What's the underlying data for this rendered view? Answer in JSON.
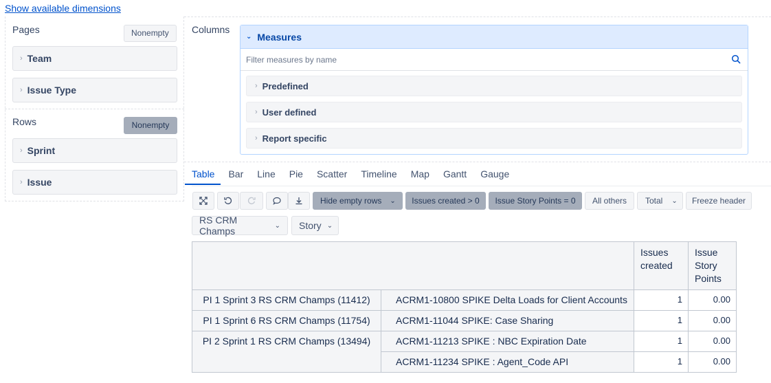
{
  "show_dimensions_link": "Show available dimensions",
  "pages": {
    "label": "Pages",
    "nonempty_label": "Nonempty",
    "items": [
      "Team",
      "Issue Type"
    ]
  },
  "rows": {
    "label": "Rows",
    "nonempty_label": "Nonempty",
    "items": [
      "Sprint",
      "Issue"
    ]
  },
  "columns": {
    "label": "Columns",
    "measures_title": "Measures",
    "filter_placeholder": "Filter measures by name",
    "groups": [
      "Predefined",
      "User defined",
      "Report specific"
    ]
  },
  "tabs": [
    "Table",
    "Bar",
    "Line",
    "Pie",
    "Scatter",
    "Timeline",
    "Map",
    "Gantt",
    "Gauge"
  ],
  "active_tab": "Table",
  "toolbar": {
    "hide_empty_rows": "Hide empty rows",
    "issues_created_filter": "Issues created > 0",
    "story_points_filter": "Issue Story Points = 0",
    "all_others": "All others",
    "total": "Total",
    "freeze_header": "Freeze header",
    "icons": [
      "expand-icon",
      "undo-icon",
      "redo-icon",
      "comment-icon",
      "download-icon"
    ]
  },
  "page_filters": {
    "team": "RS CRM Champs",
    "issue_type": "Story"
  },
  "table": {
    "headers": [
      "Issues created",
      "Issue Story Points"
    ],
    "header_lines": [
      [
        "Issues",
        "created"
      ],
      [
        "Issue",
        "Story",
        "Points"
      ]
    ],
    "rows": [
      {
        "sprint": "PI 1 Sprint 3 RS CRM Champs (11412)",
        "issue": "ACRM1-10800 SPIKE Delta Loads for Client Accounts",
        "issues_created": "1",
        "story_points": "0.00"
      },
      {
        "sprint": "PI 1 Sprint 6 RS CRM Champs (11754)",
        "issue": "ACRM1-11044 SPIKE: Case Sharing",
        "issues_created": "1",
        "story_points": "0.00"
      },
      {
        "sprint": "PI 2 Sprint 1 RS CRM Champs (13494)",
        "issue": "ACRM1-11213 SPIKE : NBC Expiration Date",
        "issues_created": "1",
        "story_points": "0.00"
      },
      {
        "sprint": "",
        "issue": "ACRM1-11234 SPIKE : Agent_Code API",
        "issues_created": "1",
        "story_points": "0.00"
      }
    ]
  },
  "colors": {
    "link": "#0052cc",
    "measures_header_bg": "#deebff",
    "active_filter_bg": "#a5adba"
  }
}
